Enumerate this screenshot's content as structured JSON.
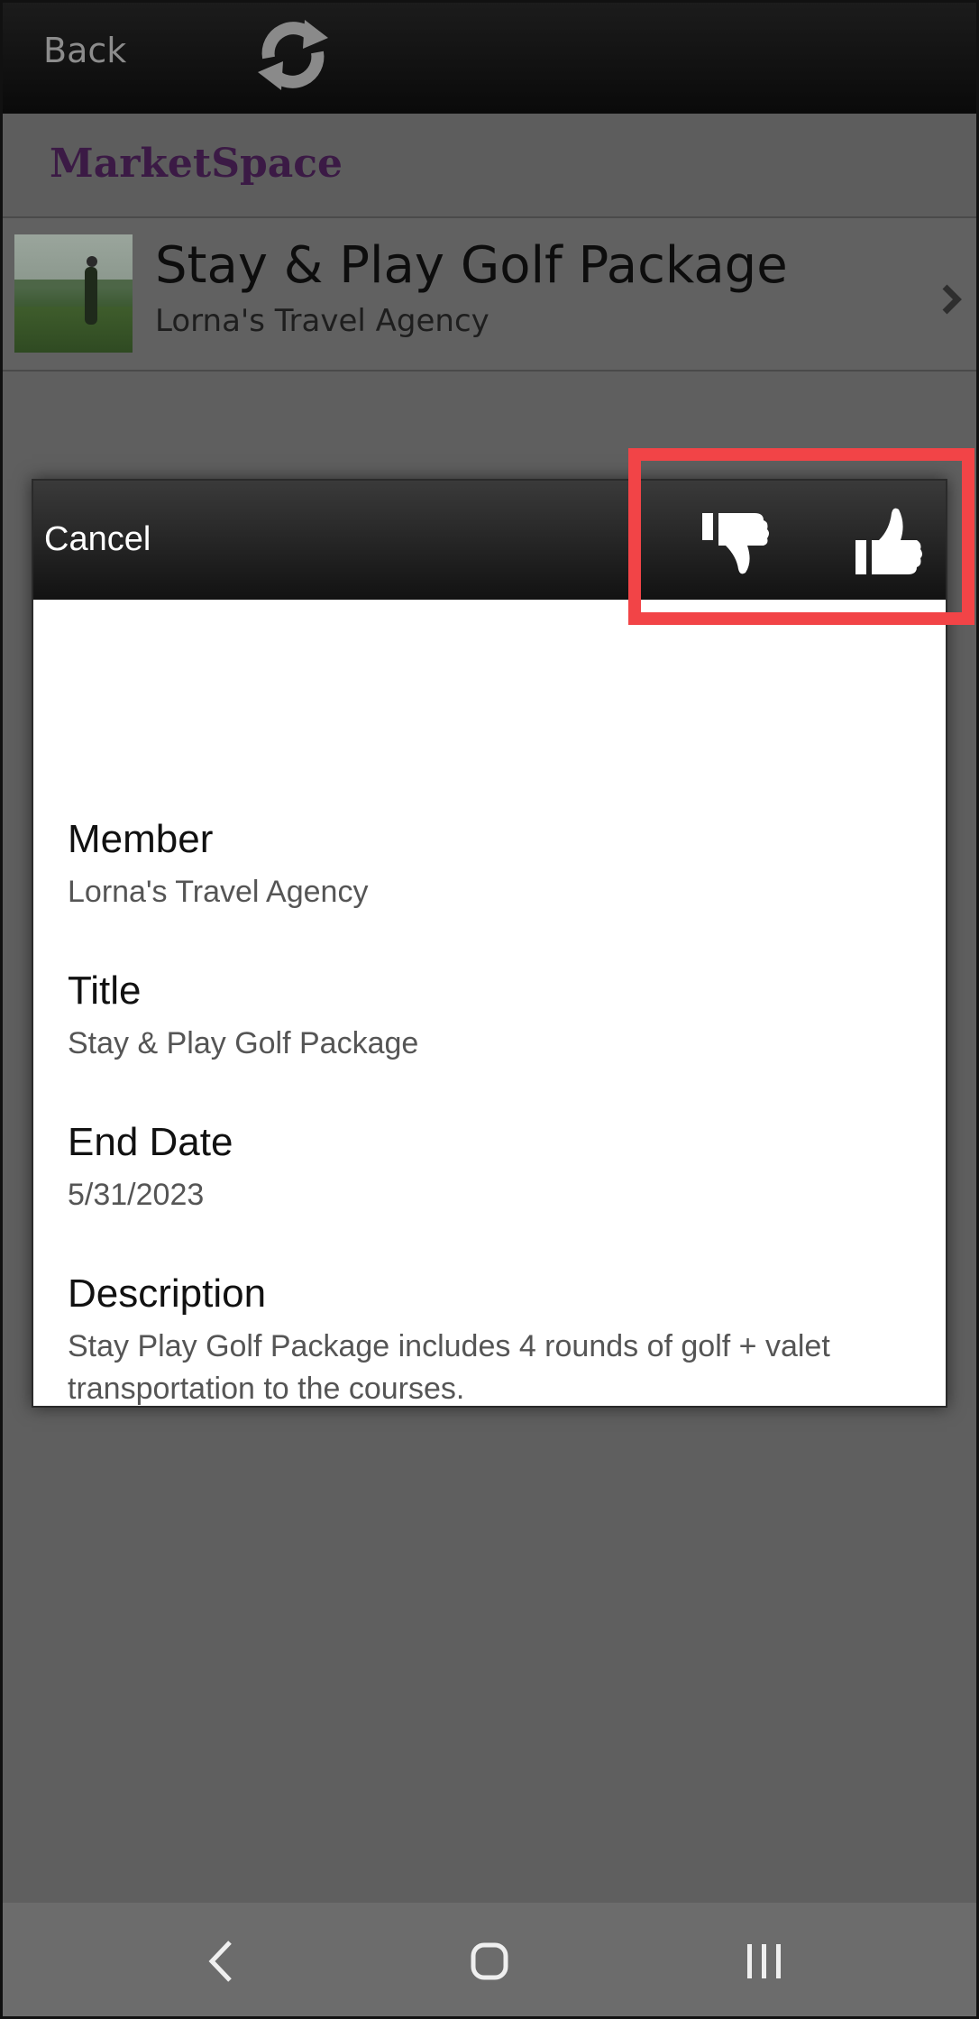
{
  "topbar": {
    "back_label": "Back",
    "refresh_icon": "refresh-icon"
  },
  "brand": {
    "title": "MarketSpace"
  },
  "listing": {
    "title": "Stay & Play Golf Package",
    "subtitle": "Lorna's Travel Agency",
    "thumbnail_icon": "golfer-photo",
    "chevron_icon": "chevron-right-icon"
  },
  "modal": {
    "cancel_label": "Cancel",
    "dislike_icon": "thumbs-down-icon",
    "like_icon": "thumbs-up-icon",
    "fields": [
      {
        "label": "Member",
        "value": "Lorna's Travel Agency"
      },
      {
        "label": "Title",
        "value": "Stay & Play Golf Package"
      },
      {
        "label": "End Date",
        "value": "5/31/2023"
      },
      {
        "label": "Description",
        "value": "Stay  Play Golf Package includes 4 rounds of golf + valet transportation to the courses."
      }
    ]
  },
  "highlight_color": "#f24447",
  "navbar": {
    "back_icon": "nav-back-icon",
    "home_icon": "nav-home-icon",
    "recents_icon": "nav-recents-icon"
  }
}
